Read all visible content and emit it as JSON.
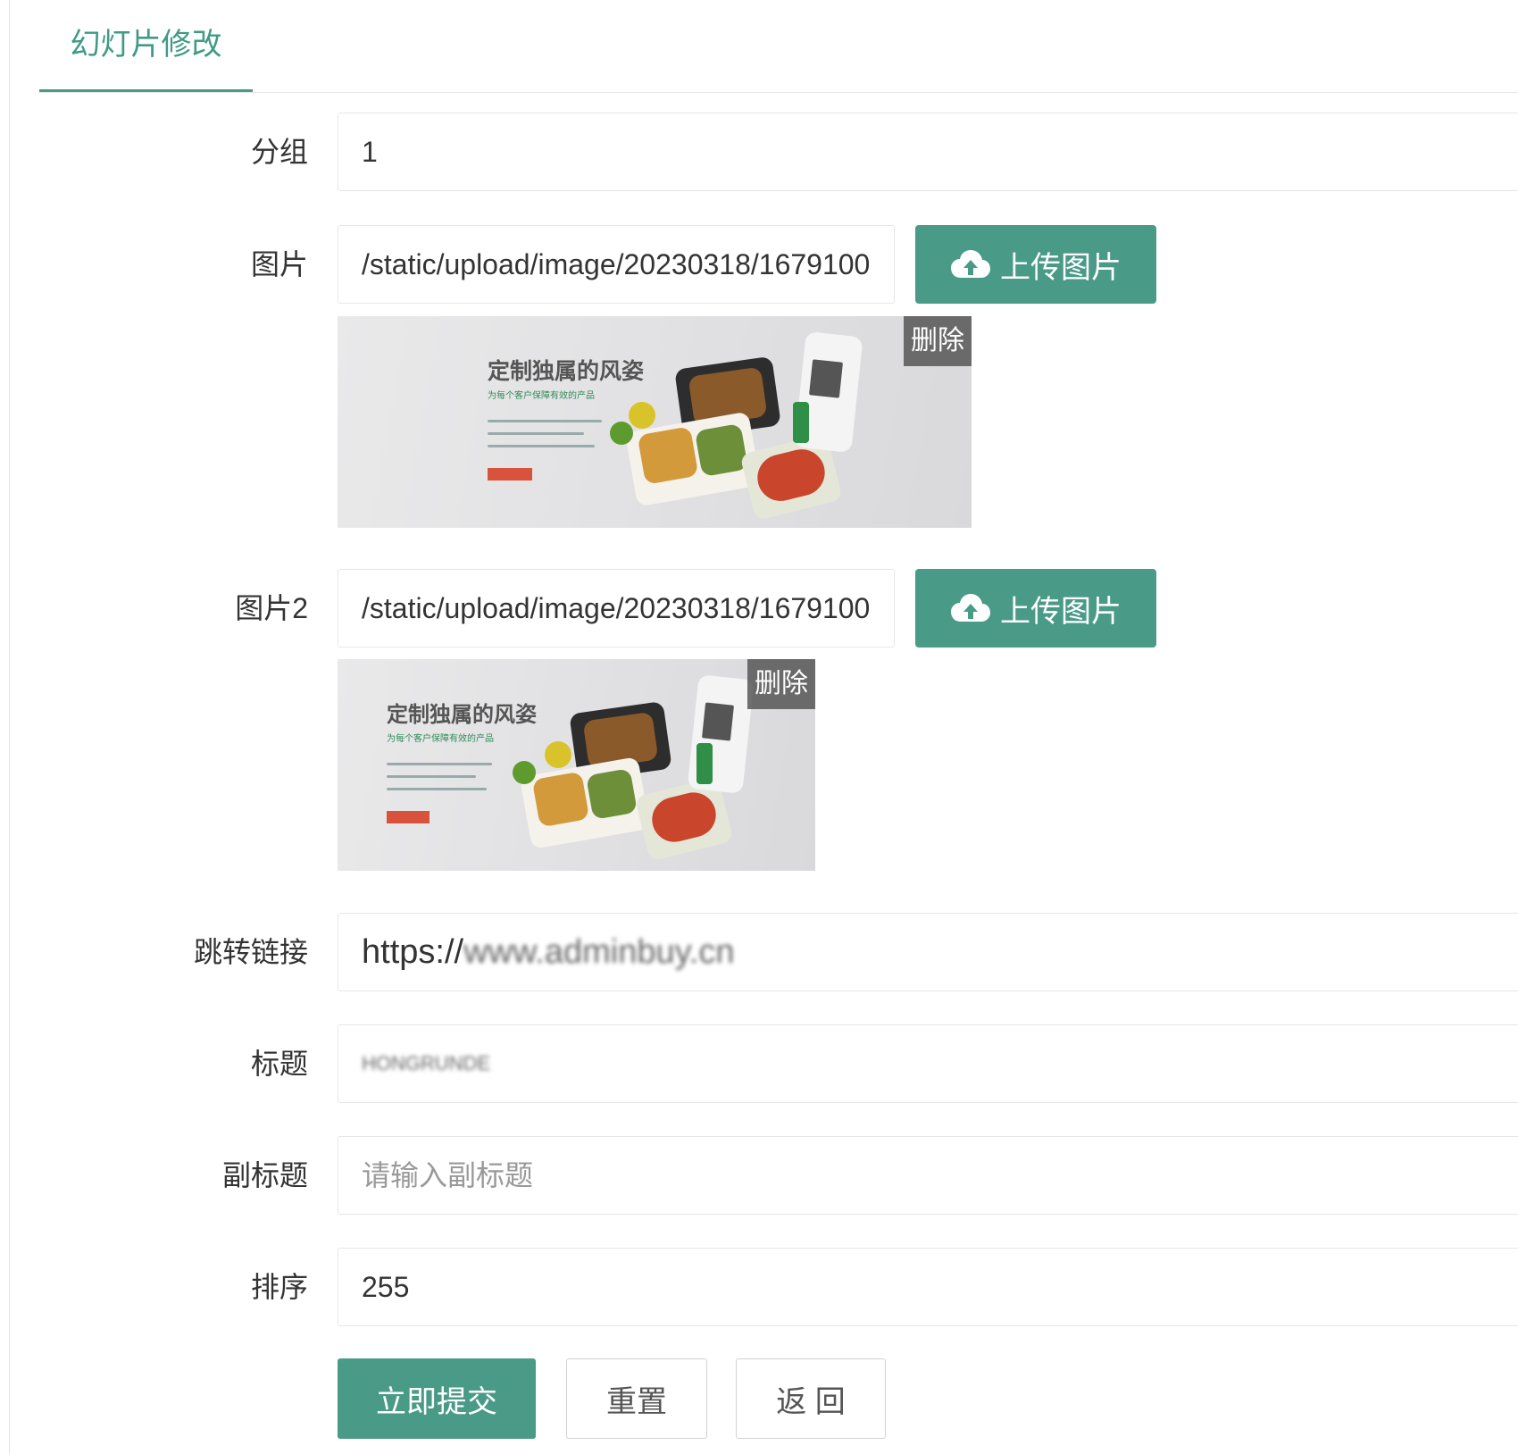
{
  "tab": {
    "label": "幻灯片修改"
  },
  "fields": {
    "group": {
      "label": "分组",
      "value": "1"
    },
    "image": {
      "label": "图片",
      "value": "/static/upload/image/20230318/1679100",
      "upload_label": "上传图片",
      "delete_label": "删除",
      "banner_headline": "定制独属的风姿",
      "banner_subline": "为每个客户保障有效的产品"
    },
    "image2": {
      "label": "图片2",
      "value": "/static/upload/image/20230318/1679100",
      "upload_label": "上传图片",
      "delete_label": "删除",
      "banner_headline": "定制独属的风姿",
      "banner_subline": "为每个客户保障有效的产品"
    },
    "link": {
      "label": "跳转链接",
      "value_prefix": "https://",
      "value_obscured": "www.adminbuy.cn"
    },
    "title": {
      "label": "标题",
      "value_obscured": "HONGRUNDE"
    },
    "subtitle": {
      "label": "副标题",
      "placeholder": "请输入副标题"
    },
    "sort": {
      "label": "排序",
      "value": "255"
    }
  },
  "actions": {
    "submit": "立即提交",
    "reset": "重置",
    "back": "返 回"
  },
  "colors": {
    "accent": "#4a9a88",
    "tab_text": "#3f9a86",
    "border": "#e6e6e6"
  },
  "icons": {
    "upload": "cloud-upload-icon"
  }
}
